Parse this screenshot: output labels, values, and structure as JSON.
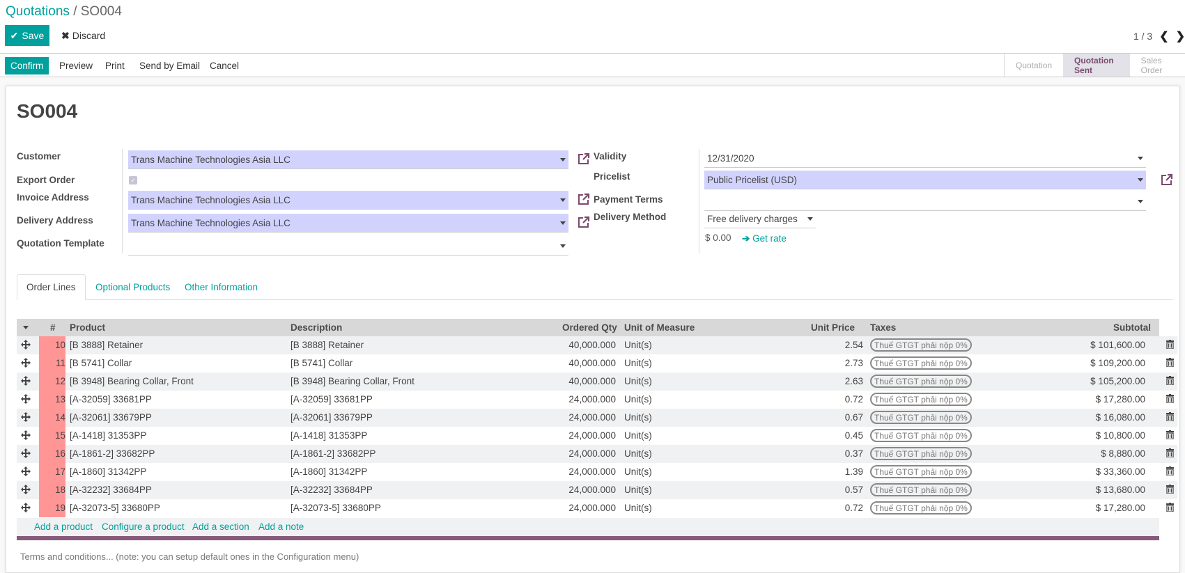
{
  "breadcrumb": {
    "parent": "Quotations",
    "separator": "/",
    "current": "SO004"
  },
  "toolbar": {
    "save_label": "Save",
    "discard_label": "Discard"
  },
  "pager": {
    "value": "1 / 3"
  },
  "header_buttons": {
    "confirm": "Confirm",
    "preview": "Preview",
    "print": "Print",
    "send_email": "Send by Email",
    "cancel": "Cancel"
  },
  "statusbar": {
    "stages": [
      "Quotation",
      "Quotation Sent",
      "Sales Order"
    ],
    "active": "Quotation Sent"
  },
  "form": {
    "title": "SO004",
    "customer": {
      "label": "Customer",
      "value": "Trans Machine Technologies Asia LLC"
    },
    "export_order": {
      "label": "Export Order",
      "checked": true
    },
    "invoice_address": {
      "label": "Invoice Address",
      "value": "Trans Machine Technologies Asia LLC"
    },
    "delivery_address": {
      "label": "Delivery Address",
      "value": "Trans Machine Technologies Asia LLC"
    },
    "quotation_template": {
      "label": "Quotation Template",
      "value": ""
    },
    "validity": {
      "label": "Validity",
      "value": "12/31/2020"
    },
    "pricelist": {
      "label": "Pricelist",
      "value": "Public Pricelist (USD)"
    },
    "payment_terms": {
      "label": "Payment Terms",
      "value": ""
    },
    "delivery_method": {
      "label": "Delivery Method",
      "value": "Free delivery charges"
    },
    "delivery_price": "$ 0.00",
    "get_rate": "Get rate"
  },
  "tabs": [
    "Order Lines",
    "Optional Products",
    "Other Information"
  ],
  "order_lines": {
    "columns": {
      "seq": "#",
      "product": "Product",
      "description": "Description",
      "qty": "Ordered Qty",
      "uom": "Unit of Measure",
      "price": "Unit Price",
      "taxes": "Taxes",
      "subtotal": "Subtotal"
    },
    "rows": [
      {
        "seq": "10",
        "product": "[B 3888] Retainer",
        "description": "[B 3888] Retainer",
        "qty": "40,000.000",
        "uom": "Unit(s)",
        "price": "2.54",
        "tax": "Thuế GTGT phải nộp 0%",
        "subtotal": "$ 101,600.00"
      },
      {
        "seq": "11",
        "product": "[B 5741] Collar",
        "description": "[B 5741] Collar",
        "qty": "40,000.000",
        "uom": "Unit(s)",
        "price": "2.73",
        "tax": "Thuế GTGT phải nộp 0%",
        "subtotal": "$ 109,200.00"
      },
      {
        "seq": "12",
        "product": "[B 3948] Bearing Collar, Front",
        "description": "[B 3948] Bearing Collar, Front",
        "qty": "40,000.000",
        "uom": "Unit(s)",
        "price": "2.63",
        "tax": "Thuế GTGT phải nộp 0%",
        "subtotal": "$ 105,200.00"
      },
      {
        "seq": "13",
        "product": "[A-32059] 33681PP",
        "description": "[A-32059] 33681PP",
        "qty": "24,000.000",
        "uom": "Unit(s)",
        "price": "0.72",
        "tax": "Thuế GTGT phải nộp 0%",
        "subtotal": "$ 17,280.00"
      },
      {
        "seq": "14",
        "product": "[A-32061] 33679PP",
        "description": "[A-32061] 33679PP",
        "qty": "24,000.000",
        "uom": "Unit(s)",
        "price": "0.67",
        "tax": "Thuế GTGT phải nộp 0%",
        "subtotal": "$ 16,080.00"
      },
      {
        "seq": "15",
        "product": "[A-1418] 31353PP",
        "description": "[A-1418] 31353PP",
        "qty": "24,000.000",
        "uom": "Unit(s)",
        "price": "0.45",
        "tax": "Thuế GTGT phải nộp 0%",
        "subtotal": "$ 10,800.00"
      },
      {
        "seq": "16",
        "product": "[A-1861-2] 33682PP",
        "description": "[A-1861-2] 33682PP",
        "qty": "24,000.000",
        "uom": "Unit(s)",
        "price": "0.37",
        "tax": "Thuế GTGT phải nộp 0%",
        "subtotal": "$ 8,880.00"
      },
      {
        "seq": "17",
        "product": "[A-1860] 31342PP",
        "description": "[A-1860] 31342PP",
        "qty": "24,000.000",
        "uom": "Unit(s)",
        "price": "1.39",
        "tax": "Thuế GTGT phải nộp 0%",
        "subtotal": "$ 33,360.00"
      },
      {
        "seq": "18",
        "product": "[A-32232] 33684PP",
        "description": "[A-32232] 33684PP",
        "qty": "24,000.000",
        "uom": "Unit(s)",
        "price": "0.57",
        "tax": "Thuế GTGT phải nộp 0%",
        "subtotal": "$ 13,680.00"
      },
      {
        "seq": "19",
        "product": "[A-32073-5] 33680PP",
        "description": "[A-32073-5] 33680PP",
        "qty": "24,000.000",
        "uom": "Unit(s)",
        "price": "0.72",
        "tax": "Thuế GTGT phải nộp 0%",
        "subtotal": "$ 17,280.00"
      }
    ],
    "add_links": [
      "Add a product",
      "Configure a product",
      "Add a section",
      "Add a note"
    ]
  },
  "terms_placeholder": "Terms and conditions... (note: you can setup default ones in the Configuration menu)",
  "colors": {
    "primary": "#00A09D",
    "required_field": "#D2D2FF",
    "accent": "#875A7B",
    "sequence_highlight": "#FF8F8F"
  }
}
